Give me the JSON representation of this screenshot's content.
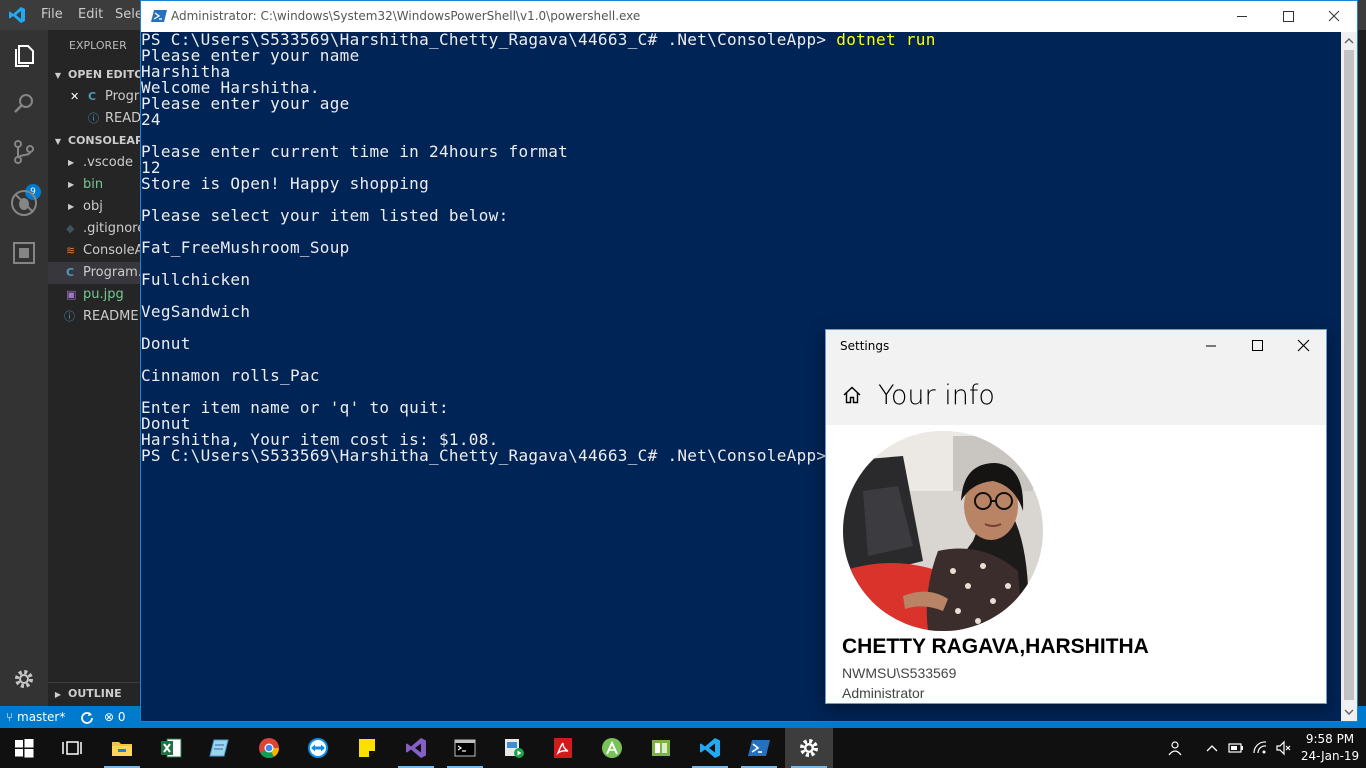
{
  "vscode": {
    "menu": [
      "File",
      "Edit",
      "Sele"
    ],
    "explorer_heading": "EXPLORER",
    "open_editors_label": "OPEN EDITOR",
    "open_editors": [
      {
        "name": "Progra",
        "icon": "csharp-icon"
      },
      {
        "name": "READI",
        "icon": "info-icon"
      }
    ],
    "project_label": "CONSOLEAPP",
    "files": [
      {
        "name": ".vscode",
        "kind": "folder",
        "color": "#cccccc"
      },
      {
        "name": "bin",
        "kind": "folder",
        "color": "#73c991"
      },
      {
        "name": "obj",
        "kind": "folder",
        "color": "#cccccc"
      },
      {
        "name": ".gitignore",
        "kind": "file",
        "color": "#cccccc"
      },
      {
        "name": "ConsoleAp",
        "kind": "file",
        "color": "#cccccc"
      },
      {
        "name": "Program.c",
        "kind": "file",
        "color": "#cccccc"
      },
      {
        "name": "pu.jpg",
        "kind": "file",
        "color": "#73c991"
      },
      {
        "name": "README.r",
        "kind": "file",
        "color": "#cccccc"
      }
    ],
    "outline_label": "OUTLINE",
    "scm_badge": "9",
    "status": {
      "branch": "master*",
      "problems": "0"
    }
  },
  "powershell": {
    "title": "Administrator: C:\\windows\\System32\\WindowsPowerShell\\v1.0\\powershell.exe",
    "prompt_first": "PS C:\\Users\\S533569\\Harshitha_Chetty_Ragava\\44663_C# .Net\\ConsoleApp> ",
    "command": "dotnet run",
    "lines": [
      "Please enter your name",
      "Harshitha",
      "Welcome Harshitha.",
      "Please enter your age",
      "24",
      "",
      "Please enter current time in 24hours format",
      "12",
      "Store is Open! Happy shopping",
      "",
      "Please select your item listed below:",
      "",
      "Fat_FreeMushroom_Soup",
      "",
      "Fullchicken",
      "",
      "VegSandwich",
      "",
      "Donut",
      "",
      "Cinnamon rolls_Pac",
      "",
      "Enter item name or 'q' to quit:",
      "Donut",
      "Harshitha, Your item cost is: $1.08.",
      "PS C:\\Users\\S533569\\Harshitha_Chetty_Ragava\\44663_C# .Net\\ConsoleApp>"
    ]
  },
  "settings": {
    "window_title": "Settings",
    "page_title": "Your info",
    "user_name": "CHETTY RAGAVA,HARSHITHA",
    "account": "NWMSU\\S533569",
    "role": "Administrator"
  },
  "taskbar": {
    "time": "9:58 PM",
    "date": "24-Jan-19",
    "apps": [
      "start-icon",
      "task-view-icon",
      "file-explorer-icon",
      "excel-icon",
      "notepad-icon",
      "chrome-icon",
      "teamviewer-icon",
      "sticky-notes-icon",
      "visual-studio-icon",
      "cmd-icon",
      "media-icon",
      "acrobat-icon",
      "android-studio-icon",
      "green-app-icon",
      "vscode-icon",
      "powershell-icon",
      "settings-icon"
    ]
  },
  "colors": {
    "ps_background": "#012456",
    "ps_command": "#ffff00",
    "vscode_status": "#007acc",
    "taskbar": "#101010"
  }
}
